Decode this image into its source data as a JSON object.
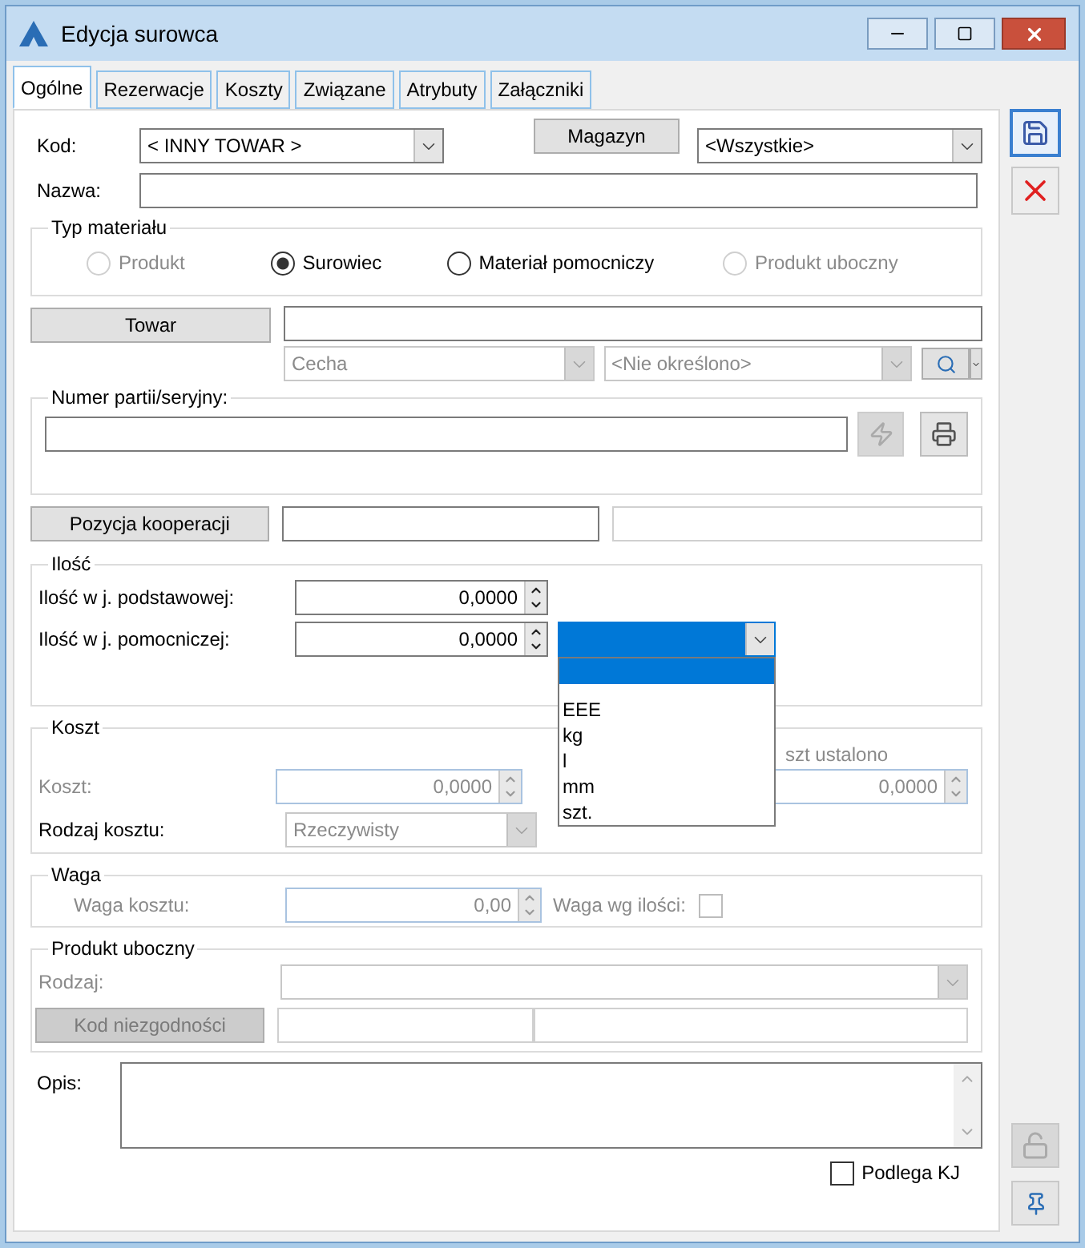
{
  "window": {
    "title": "Edycja surowca"
  },
  "tabs": [
    {
      "label": "Ogólne",
      "selected": true
    },
    {
      "label": "Rezerwacje",
      "selected": false
    },
    {
      "label": "Koszty",
      "selected": false
    },
    {
      "label": "Związane",
      "selected": false
    },
    {
      "label": "Atrybuty",
      "selected": false
    },
    {
      "label": "Załączniki",
      "selected": false
    }
  ],
  "header": {
    "kod_label": "Kod:",
    "kod_value": "< INNY TOWAR >",
    "magazyn_button": "Magazyn",
    "magazyn_value": "<Wszystkie>",
    "nazwa_label": "Nazwa:"
  },
  "typ_materialu": {
    "title": "Typ materiału",
    "options": [
      {
        "label": "Produkt",
        "selected": false,
        "disabled": true
      },
      {
        "label": "Surowiec",
        "selected": true,
        "disabled": false
      },
      {
        "label": "Materiał pomocniczy",
        "selected": false,
        "disabled": false
      },
      {
        "label": "Produkt uboczny",
        "selected": false,
        "disabled": true
      }
    ]
  },
  "towar": {
    "button": "Towar",
    "cecha": "Cecha",
    "cecha_value": "<Nie określono>"
  },
  "numer_partii": {
    "title": "Numer partii/seryjny:"
  },
  "pozycja_kooperacji": {
    "button": "Pozycja kooperacji"
  },
  "ilosc": {
    "title": "Ilość",
    "rows": [
      {
        "label": "Ilość w j. podstawowej:",
        "value": "0,0000"
      },
      {
        "label": "Ilość w j. pomocniczej:",
        "value": "0,0000"
      }
    ],
    "unit_dropdown": {
      "expanded": true,
      "options": [
        {
          "selected": true
        },
        {
          "label": "EEE",
          "selected": false
        },
        {
          "label": "kg",
          "selected": false
        },
        {
          "label": "l",
          "selected": false
        },
        {
          "label": "mm",
          "selected": false
        },
        {
          "label": "szt.",
          "selected": false
        }
      ]
    }
  },
  "koszt": {
    "title": "Koszt",
    "label": "Koszt:",
    "disabled": true,
    "value": "0,0000",
    "partial_label": "szt ustalono",
    "fixed_value": "0,0000",
    "rodzaj_label": "Rodzaj kosztu:",
    "rodzaj_value": "Rzeczywisty"
  },
  "waga": {
    "title": "Waga",
    "label": "Waga kosztu:",
    "disabled": true,
    "value": "0,00",
    "by_qty_label": "Waga wg ilości:",
    "by_qty_checked": false
  },
  "produkt_uboczny": {
    "title": "Produkt uboczny",
    "disabled": true,
    "rodzaj_label": "Rodzaj:",
    "kod_button": "Kod niezgodności"
  },
  "opis": {
    "label": "Opis:"
  },
  "podlega_kj": {
    "label": "Podlega KJ",
    "checked": false
  }
}
